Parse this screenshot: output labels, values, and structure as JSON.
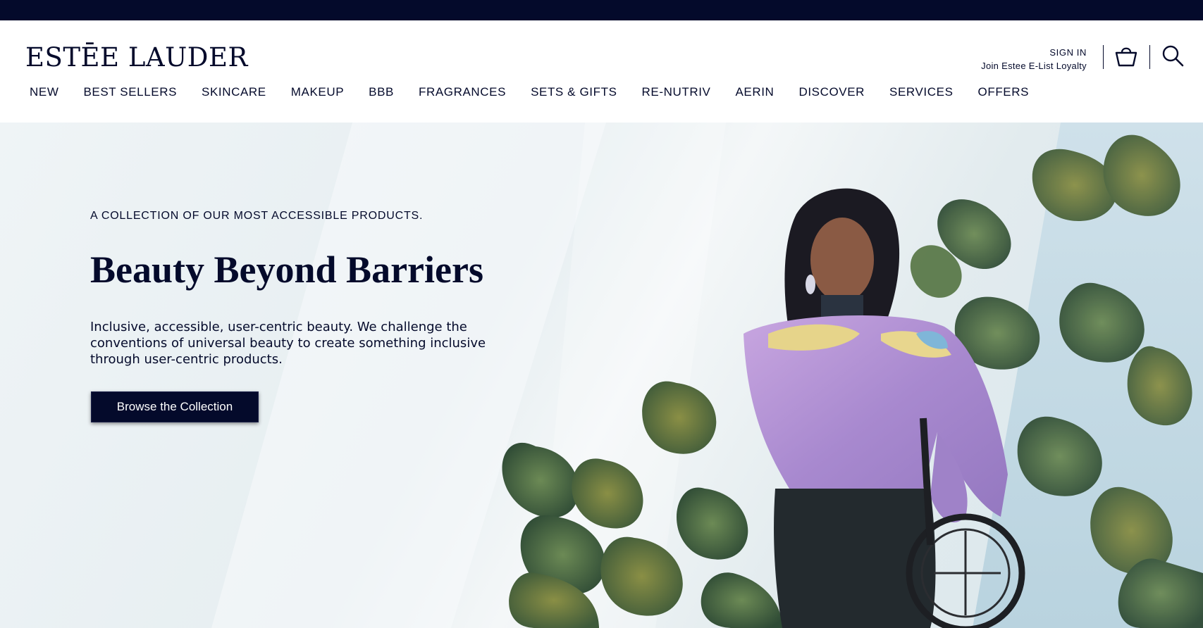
{
  "brand": {
    "logo_text": "ESTĒE LAUDER"
  },
  "account": {
    "sign_in": "SIGN IN",
    "loyalty": "Join Estee E-List Loyalty"
  },
  "icons": {
    "bag": "shopping-bag-icon",
    "search": "search-icon"
  },
  "nav": {
    "items": [
      {
        "label": "NEW"
      },
      {
        "label": "BEST SELLERS"
      },
      {
        "label": "SKINCARE"
      },
      {
        "label": "MAKEUP"
      },
      {
        "label": "BBB"
      },
      {
        "label": "FRAGRANCES"
      },
      {
        "label": "SETS & GIFTS"
      },
      {
        "label": "RE-NUTRIV"
      },
      {
        "label": "AERIN"
      },
      {
        "label": "DISCOVER"
      },
      {
        "label": "SERVICES"
      },
      {
        "label": "OFFERS"
      }
    ]
  },
  "hero": {
    "eyebrow": "A COLLECTION OF OUR MOST ACCESSIBLE PRODUCTS.",
    "headline": "Beauty Beyond Barriers",
    "body": "Inclusive, accessible, user-centric beauty. We challenge the conventions of universal beauty to create something inclusive through user-centric products.",
    "cta_label": "Browse the Collection"
  },
  "colors": {
    "navy": "#040a2b",
    "white": "#ffffff",
    "hero_bg": "#e6eef1"
  }
}
